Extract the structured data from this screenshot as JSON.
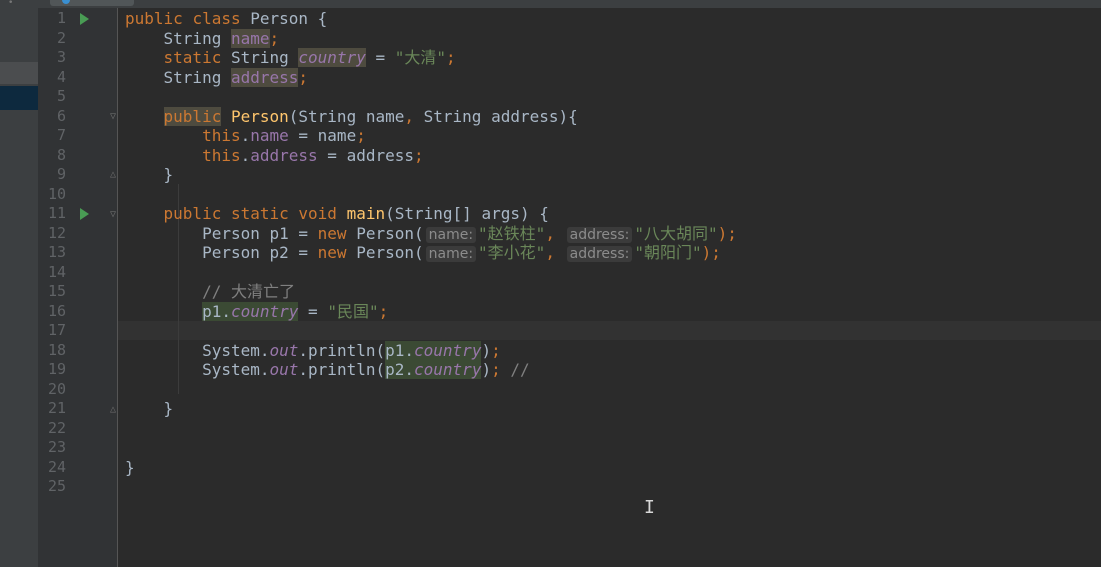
{
  "editor": {
    "line_numbers": [
      "1",
      "2",
      "3",
      "4",
      "5",
      "6",
      "7",
      "8",
      "9",
      "10",
      "11",
      "12",
      "13",
      "14",
      "15",
      "16",
      "17",
      "18",
      "19",
      "20",
      "21",
      "22",
      "23",
      "24",
      "25"
    ],
    "code": {
      "l1": {
        "public": "public",
        "class": "class",
        "name": "Person",
        "brace": " {"
      },
      "l2": {
        "type": "String",
        "field": "name",
        "semi": ";"
      },
      "l3": {
        "static": "static",
        "type": "String",
        "field": "country",
        "eq": " = ",
        "value": "\"大清\"",
        "semi": ";"
      },
      "l4": {
        "type": "String",
        "field": "address",
        "semi": ";"
      },
      "l6": {
        "public": "public",
        "ctor": "Person",
        "params": "(String name",
        "comma": ",",
        "params2": " String address){"
      },
      "l7": {
        "this": "this",
        "dot": ".",
        "field": "name",
        "rest": " = name",
        "semi": ";"
      },
      "l8": {
        "this": "this",
        "dot": ".",
        "field": "address",
        "rest": " = address",
        "semi": ";"
      },
      "l9": {
        "brace": "}"
      },
      "l11": {
        "public": "public",
        "static": "static",
        "void": "void",
        "method": "main",
        "rest": "(String[] args) {"
      },
      "l12": {
        "decl": "Person p1 = ",
        "new": "new",
        "ctor": " Person(",
        "hint1": "name:",
        "arg1": "\"赵铁柱\"",
        "comma": ",",
        "hint2": "address:",
        "arg2": "\"八大胡同\"",
        "close": ");"
      },
      "l13": {
        "decl": "Person p2 = ",
        "new": "new",
        "ctor": " Person(",
        "hint1": "name:",
        "arg1": "\"李小花\"",
        "comma": ",",
        "hint2": "address:",
        "arg2": "\"朝阳门\"",
        "close": ");"
      },
      "l15": {
        "comment": "// 大清亡了"
      },
      "l16": {
        "obj": "p1.",
        "field": "country",
        "eq": " = ",
        "value": "\"民国\"",
        "semi": ";"
      },
      "l18": {
        "prefix": "System.",
        "out": "out",
        "call": ".println(",
        "obj": "p1.",
        "field": "country",
        "close": ")",
        "semi": ";"
      },
      "l19": {
        "prefix": "System.",
        "out": "out",
        "call": ".println(",
        "obj": "p2.",
        "field": "country",
        "close": ")",
        "semi": ";",
        "comment": " //"
      },
      "l21": {
        "brace": "}"
      },
      "l24": {
        "brace": "}"
      }
    }
  }
}
